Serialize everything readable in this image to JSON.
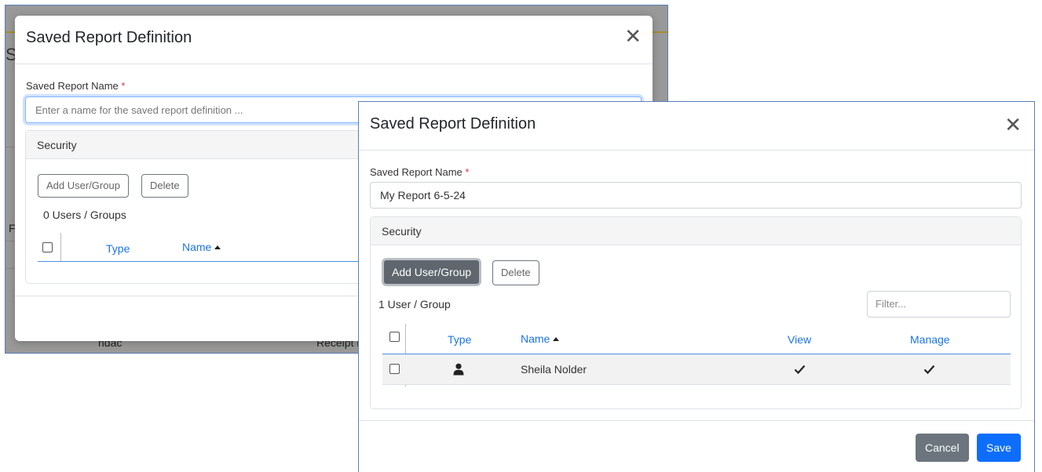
{
  "colors": {
    "accent": "#1b74e4",
    "save": "#0d6efd",
    "cancel": "#6c757d",
    "required": "#dc3545"
  },
  "background_app": {
    "partial_texts": [
      "Sa",
      "F",
      "ndac",
      "Receipt r"
    ]
  },
  "dialog_back": {
    "title": "Saved Report Definition",
    "name_label": "Saved Report Name",
    "required_mark": "*",
    "name_placeholder": "Enter a name for the saved report definition ...",
    "security_title": "Security",
    "add_label": "Add User/Group",
    "delete_label": "Delete",
    "count_text": "0 Users / Groups",
    "columns": {
      "type": "Type",
      "name": "Name"
    },
    "close_icon": "close-icon"
  },
  "dialog_front": {
    "title": "Saved Report Definition",
    "name_label": "Saved Report Name",
    "required_mark": "*",
    "name_value": "My Report 6-5-24",
    "security_title": "Security",
    "add_label": "Add User/Group",
    "delete_label": "Delete",
    "count_text": "1 User / Group",
    "filter_placeholder": "Filter...",
    "columns": {
      "type": "Type",
      "name": "Name",
      "view": "View",
      "manage": "Manage"
    },
    "rows": [
      {
        "type_icon": "user-icon",
        "name": "Sheila Nolder",
        "view": true,
        "manage": true
      }
    ],
    "cancel_label": "Cancel",
    "save_label": "Save"
  }
}
